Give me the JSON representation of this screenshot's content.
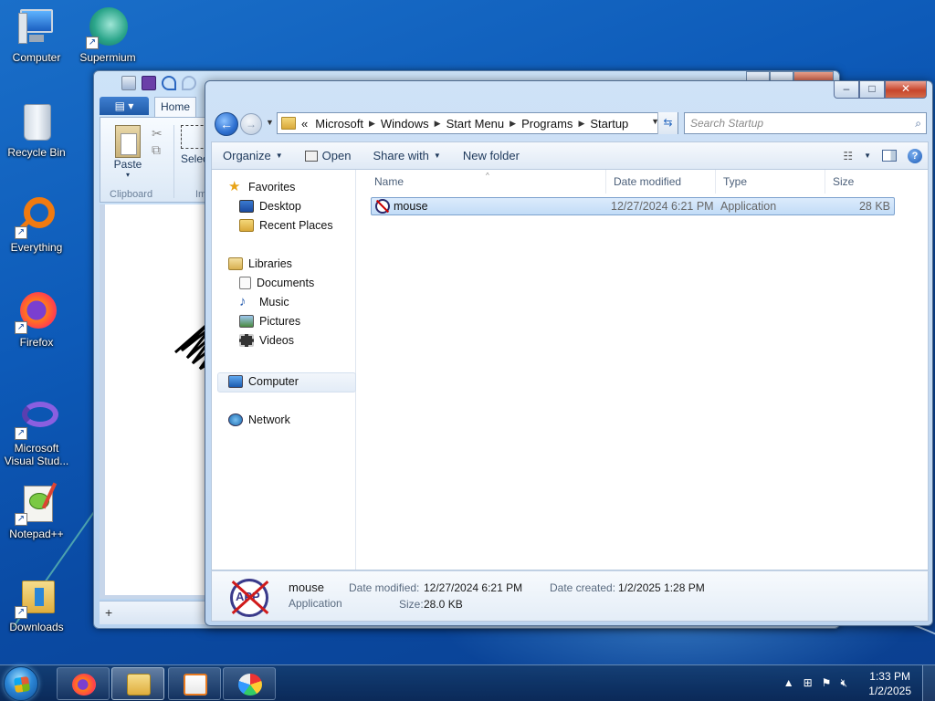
{
  "desktop": {
    "icons": [
      {
        "label": "Computer",
        "icon": "computer-icon"
      },
      {
        "label": "Supermium",
        "icon": "supermium-icon"
      },
      {
        "label": "Recycle Bin",
        "icon": "recycle-bin-icon"
      },
      {
        "label": "Everything",
        "icon": "everything-icon"
      },
      {
        "label": "Firefox",
        "icon": "firefox-icon"
      },
      {
        "label": "Microsoft Visual Stud...",
        "icon": "visual-studio-icon"
      },
      {
        "label": "Notepad++",
        "icon": "notepad-plus-plus-icon"
      },
      {
        "label": "Downloads",
        "icon": "downloads-folder-icon"
      }
    ]
  },
  "paint": {
    "home_tab": "Home",
    "paste_label": "Paste",
    "select_label": "Selec",
    "clipboard_group": "Clipboard",
    "image_group": "Im",
    "status_cursor": "+"
  },
  "explorer": {
    "controls": {
      "minimize": "–",
      "maximize": "□",
      "close": "✕"
    },
    "address": {
      "overflow": "«",
      "crumbs": [
        "Microsoft",
        "Windows",
        "Start Menu",
        "Programs",
        "Startup"
      ]
    },
    "search": {
      "placeholder": "Search Startup"
    },
    "toolbar": {
      "organize": "Organize",
      "open": "Open",
      "share_with": "Share with",
      "new_folder": "New folder"
    },
    "nav": {
      "favorites": "Favorites",
      "desktop": "Desktop",
      "recent_places": "Recent Places",
      "libraries": "Libraries",
      "documents": "Documents",
      "music": "Music",
      "pictures": "Pictures",
      "videos": "Videos",
      "computer": "Computer",
      "network": "Network"
    },
    "columns": {
      "name": "Name",
      "date_modified": "Date modified",
      "type": "Type",
      "size": "Size"
    },
    "files": [
      {
        "name": "mouse",
        "date_modified": "12/27/2024 6:21 PM",
        "type": "Application",
        "size": "28 KB"
      }
    ],
    "details": {
      "icon_text": "APP",
      "name": "mouse",
      "type": "Application",
      "date_modified_label": "Date modified:",
      "date_modified": "12/27/2024 6:21 PM",
      "date_created_label": "Date created:",
      "date_created": "1/2/2025 1:28 PM",
      "size_label": "Size:",
      "size": "28.0 KB"
    }
  },
  "taskbar": {
    "time": "1:33 PM",
    "date": "1/2/2025",
    "tray_icons": [
      "show-hidden-icons-icon",
      "network-icon",
      "action-center-flag-icon",
      "volume-muted-icon"
    ]
  }
}
